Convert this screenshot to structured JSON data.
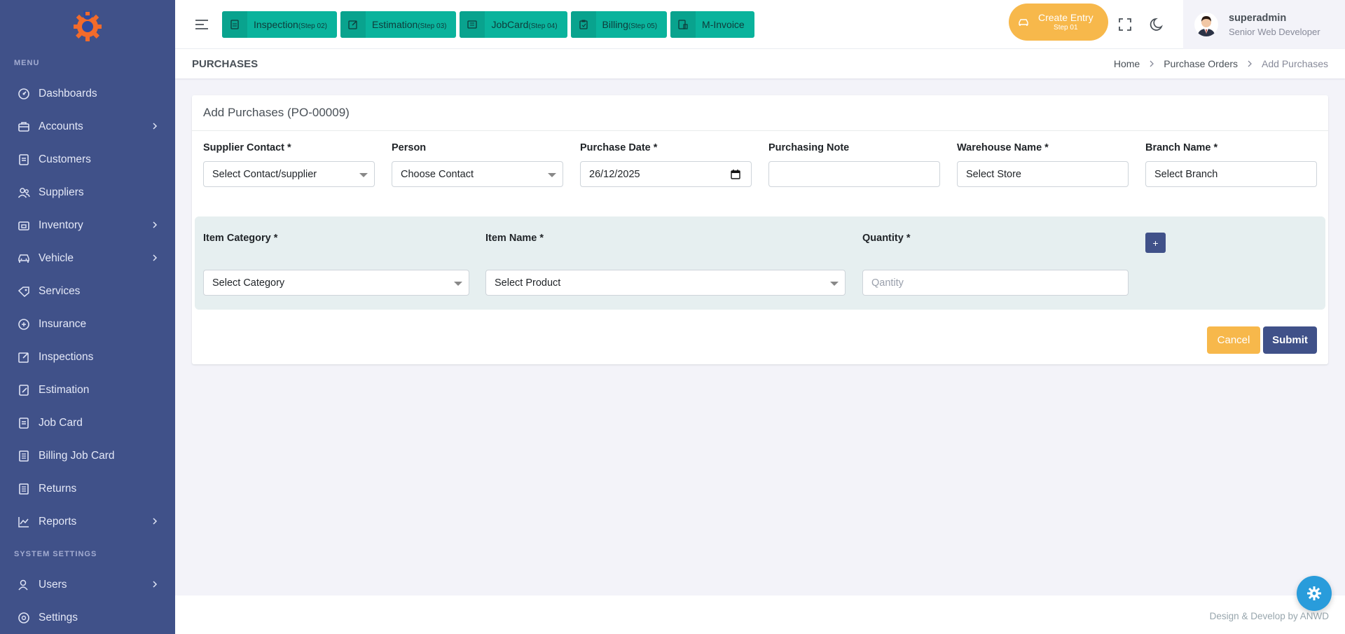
{
  "sidebar": {
    "menu_title": "MENU",
    "items": [
      {
        "label": "Dashboards",
        "icon": "dashboard-icon"
      },
      {
        "label": "Accounts",
        "icon": "briefcase-icon",
        "has_children": true
      },
      {
        "label": "Customers",
        "icon": "document-icon"
      },
      {
        "label": "Suppliers",
        "icon": "users-icon"
      },
      {
        "label": "Inventory",
        "icon": "inventory-icon",
        "has_children": true
      },
      {
        "label": "Vehicle",
        "icon": "car-icon",
        "has_children": true
      },
      {
        "label": "Services",
        "icon": "services-icon"
      },
      {
        "label": "Insurance",
        "icon": "insurance-icon"
      },
      {
        "label": "Inspections",
        "icon": "edit-icon"
      },
      {
        "label": "Estimation",
        "icon": "estimation-icon"
      },
      {
        "label": "Job Card",
        "icon": "document-icon"
      },
      {
        "label": "Billing Job Card",
        "icon": "list-icon"
      },
      {
        "label": "Returns",
        "icon": "list-icon"
      },
      {
        "label": "Reports",
        "icon": "chart-icon",
        "has_children": true
      }
    ],
    "system_title": "SYSTEM SETTINGS",
    "system_items": [
      {
        "label": "Users",
        "icon": "user-icon",
        "has_children": true
      },
      {
        "label": "Settings",
        "icon": "settings-icon"
      }
    ]
  },
  "topbar": {
    "steps": [
      {
        "label": "Inspection",
        "sub": "(Step 02)"
      },
      {
        "label": "Estimation",
        "sub": "(Step 03)"
      },
      {
        "label": "JobCard",
        "sub": "(Step 04)"
      },
      {
        "label": "Billing",
        "sub": "(Step 05)"
      },
      {
        "label": "M-Invoice",
        "sub": ""
      }
    ],
    "create_entry": {
      "label": "Create Entry",
      "sub": "Step 01"
    },
    "user": {
      "name": "superadmin",
      "role": "Senior Web Developer"
    }
  },
  "titlebar": {
    "title": "PURCHASES",
    "breadcrumb": [
      "Home",
      "Purchase Orders",
      "Add Purchases"
    ]
  },
  "form": {
    "header": "Add Purchases (PO-00009)",
    "supplier_label": "Supplier Contact *",
    "supplier_value": "Select Contact/supplier",
    "person_label": "Person",
    "person_value": "Choose Contact",
    "date_label": "Purchase Date *",
    "date_value": "26/12/2025",
    "note_label": "Purchasing Note",
    "note_value": "",
    "warehouse_label": "Warehouse Name *",
    "warehouse_value": "Select Store",
    "branch_label": "Branch Name *",
    "branch_value": "Select Branch",
    "item_category_label": "Item Category *",
    "item_category_value": "Select Category",
    "item_name_label": "Item Name *",
    "item_name_value": "Select Product",
    "quantity_label": "Quantity *",
    "quantity_placeholder": "Qantity",
    "add_row_label": "+",
    "cancel_label": "Cancel",
    "submit_label": "Submit"
  },
  "footer": {
    "text": "Design & Develop by ANWD"
  },
  "colors": {
    "sidebar": "#405189",
    "step_button": "#0ab39c",
    "warning": "#f7b84b",
    "primary": "#405189",
    "info": "#299cdb"
  }
}
